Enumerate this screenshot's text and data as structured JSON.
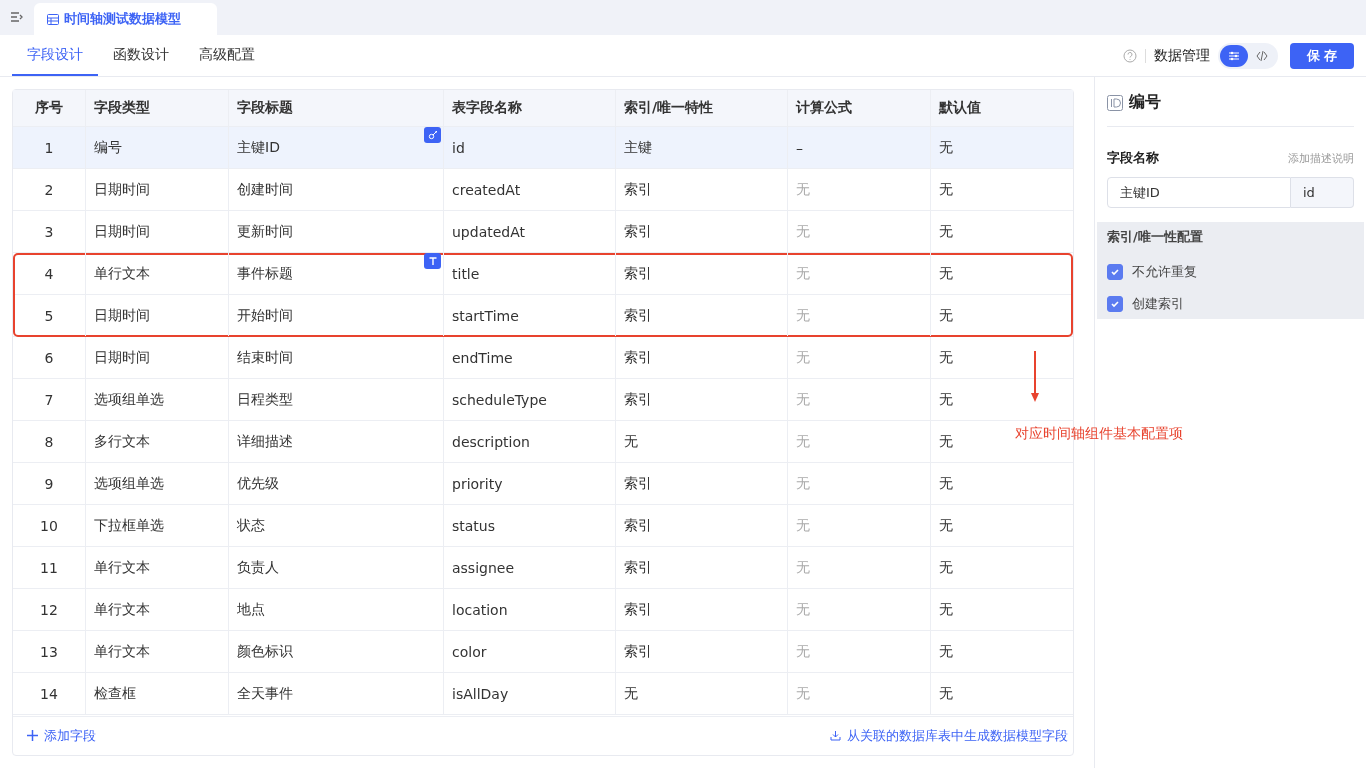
{
  "doc_tab": {
    "title": "时间轴测试数据模型"
  },
  "tabs": [
    {
      "label": "字段设计",
      "selected": true
    },
    {
      "label": "函数设计",
      "selected": false
    },
    {
      "label": "高级配置",
      "selected": false
    }
  ],
  "toolbar": {
    "data_manage": "数据管理",
    "view_modes": [
      {
        "kind": "settings",
        "selected": true
      },
      {
        "kind": "code",
        "selected": false
      }
    ],
    "save": "保 存"
  },
  "table": {
    "columns": [
      "序号",
      "字段类型",
      "字段标题",
      "表字段名称",
      "索引/唯一特性",
      "计算公式",
      "默认值"
    ],
    "rows": [
      {
        "no": "1",
        "type": "编号",
        "title": "主键ID",
        "name": "id",
        "index": "主键",
        "formula": "–",
        "default": "无",
        "badge": {
          "kind": "key"
        },
        "selected": true,
        "highlighted": false
      },
      {
        "no": "2",
        "type": "日期时间",
        "title": "创建时间",
        "name": "createdAt",
        "index": "索引",
        "formula": "无",
        "default": "无",
        "selected": false,
        "highlighted": false
      },
      {
        "no": "3",
        "type": "日期时间",
        "title": "更新时间",
        "name": "updatedAt",
        "index": "索引",
        "formula": "无",
        "default": "无",
        "selected": false,
        "highlighted": false
      },
      {
        "no": "4",
        "type": "单行文本",
        "title": "事件标题",
        "name": "title",
        "index": "索引",
        "formula": "无",
        "default": "无",
        "badge": {
          "kind": "text"
        },
        "selected": false,
        "highlighted": true
      },
      {
        "no": "5",
        "type": "日期时间",
        "title": "开始时间",
        "name": "startTime",
        "index": "索引",
        "formula": "无",
        "default": "无",
        "selected": false,
        "highlighted": true
      },
      {
        "no": "6",
        "type": "日期时间",
        "title": "结束时间",
        "name": "endTime",
        "index": "索引",
        "formula": "无",
        "default": "无",
        "selected": false,
        "highlighted": false
      },
      {
        "no": "7",
        "type": "选项组单选",
        "title": "日程类型",
        "name": "scheduleType",
        "index": "索引",
        "formula": "无",
        "default": "无",
        "selected": false,
        "highlighted": false
      },
      {
        "no": "8",
        "type": "多行文本",
        "title": "详细描述",
        "name": "description",
        "index": "无",
        "formula": "无",
        "default": "无",
        "selected": false,
        "highlighted": false
      },
      {
        "no": "9",
        "type": "选项组单选",
        "title": "优先级",
        "name": "priority",
        "index": "索引",
        "formula": "无",
        "default": "无",
        "selected": false,
        "highlighted": false
      },
      {
        "no": "10",
        "type": "下拉框单选",
        "title": "状态",
        "name": "status",
        "index": "索引",
        "formula": "无",
        "default": "无",
        "selected": false,
        "highlighted": false
      },
      {
        "no": "11",
        "type": "单行文本",
        "title": "负责人",
        "name": "assignee",
        "index": "索引",
        "formula": "无",
        "default": "无",
        "selected": false,
        "highlighted": false
      },
      {
        "no": "12",
        "type": "单行文本",
        "title": "地点",
        "name": "location",
        "index": "索引",
        "formula": "无",
        "default": "无",
        "selected": false,
        "highlighted": false
      },
      {
        "no": "13",
        "type": "单行文本",
        "title": "颜色标识",
        "name": "color",
        "index": "索引",
        "formula": "无",
        "default": "无",
        "selected": false,
        "highlighted": false
      },
      {
        "no": "14",
        "type": "检查框",
        "title": "全天事件",
        "name": "isAllDay",
        "index": "无",
        "formula": "无",
        "default": "无",
        "selected": false,
        "highlighted": false
      }
    ],
    "add_field": "添加字段",
    "generate": "从关联的数据库表中生成数据模型字段"
  },
  "annotation": {
    "text": "对应时间轴组件基本配置项"
  },
  "panel": {
    "title": "编号",
    "field_label": "字段名称",
    "add_desc": "添加描述说明",
    "title_value": "主键ID",
    "name_value": "id",
    "index_section": "索引/唯一性配置",
    "options": [
      {
        "label": "不允许重复",
        "checked": true
      },
      {
        "label": "创建索引",
        "checked": true
      }
    ]
  }
}
